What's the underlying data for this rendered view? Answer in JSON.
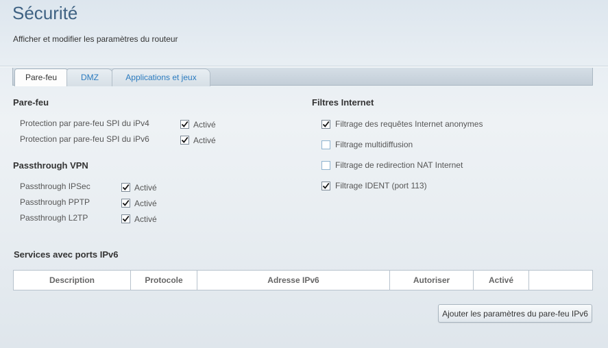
{
  "page": {
    "title": "Sécurité",
    "subtitle": "Afficher et modifier les paramètres du routeur"
  },
  "tabs": [
    {
      "label": "Pare-feu",
      "active": true
    },
    {
      "label": "DMZ",
      "active": false
    },
    {
      "label": "Applications et jeux",
      "active": false
    }
  ],
  "firewall": {
    "title": "Pare-feu",
    "rows": [
      {
        "label": "Protection par pare-feu SPI du iPv4",
        "checkbox_label": "Activé",
        "checked": true
      },
      {
        "label": "Protection par pare-feu SPI du iPv6",
        "checkbox_label": "Activé",
        "checked": true
      }
    ]
  },
  "vpn": {
    "title": "Passthrough VPN",
    "rows": [
      {
        "label": "Passthrough IPSec",
        "checkbox_label": "Activé",
        "checked": true
      },
      {
        "label": "Passthrough PPTP",
        "checkbox_label": "Activé",
        "checked": true
      },
      {
        "label": "Passthrough L2TP",
        "checkbox_label": "Activé",
        "checked": true
      }
    ]
  },
  "filters": {
    "title": "Filtres Internet",
    "items": [
      {
        "label": "Filtrage des requêtes Internet anonymes",
        "checked": true
      },
      {
        "label": "Filtrage multidiffusion",
        "checked": false
      },
      {
        "label": "Filtrage de redirection NAT Internet",
        "checked": false
      },
      {
        "label": "Filtrage IDENT (port 113)",
        "checked": true
      }
    ]
  },
  "ipv6_services": {
    "title": "Services avec ports IPv6",
    "columns": [
      "Description",
      "Protocole",
      "Adresse IPv6",
      "Autoriser",
      "Activé",
      ""
    ],
    "rows": []
  },
  "add_button_label": "Ajouter les paramètres du pare-feu IPv6",
  "colors": {
    "title": "#3f6283",
    "tab_link": "#2b7bbf"
  }
}
